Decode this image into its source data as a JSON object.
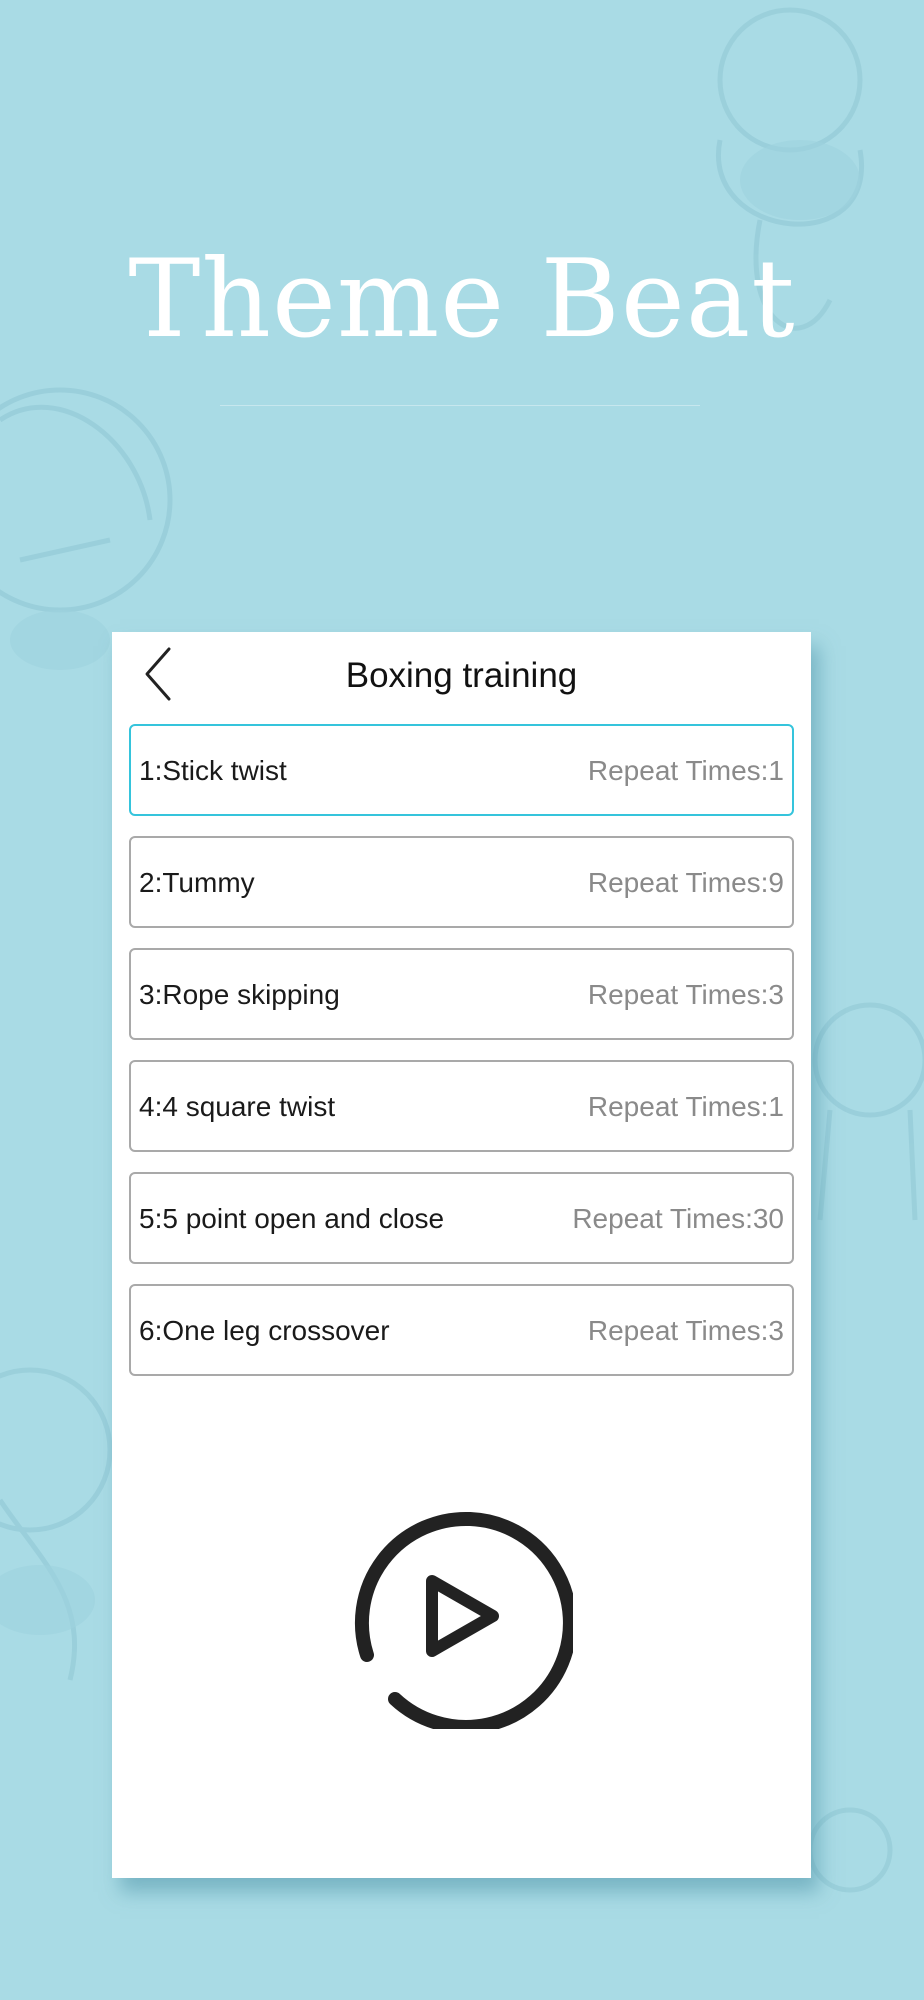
{
  "hero": {
    "title": "Theme Beat"
  },
  "screen": {
    "title": "Boxing training",
    "back_icon": "chevron-left-icon",
    "play_icon": "play-circle-icon",
    "accent_color": "#35c4dc",
    "background_color": "#a9dbe5",
    "exercises": [
      {
        "name": "1:Stick twist",
        "repeat": "Repeat Times:1",
        "selected": true
      },
      {
        "name": "2:Tummy",
        "repeat": "Repeat Times:9",
        "selected": false
      },
      {
        "name": "3:Rope skipping",
        "repeat": "Repeat Times:3",
        "selected": false
      },
      {
        "name": "4:4 square twist",
        "repeat": "Repeat Times:1",
        "selected": false
      },
      {
        "name": "5:5 point open and close",
        "repeat": "Repeat Times:30",
        "selected": false
      },
      {
        "name": "6:One leg crossover",
        "repeat": "Repeat Times:3",
        "selected": false
      }
    ]
  }
}
